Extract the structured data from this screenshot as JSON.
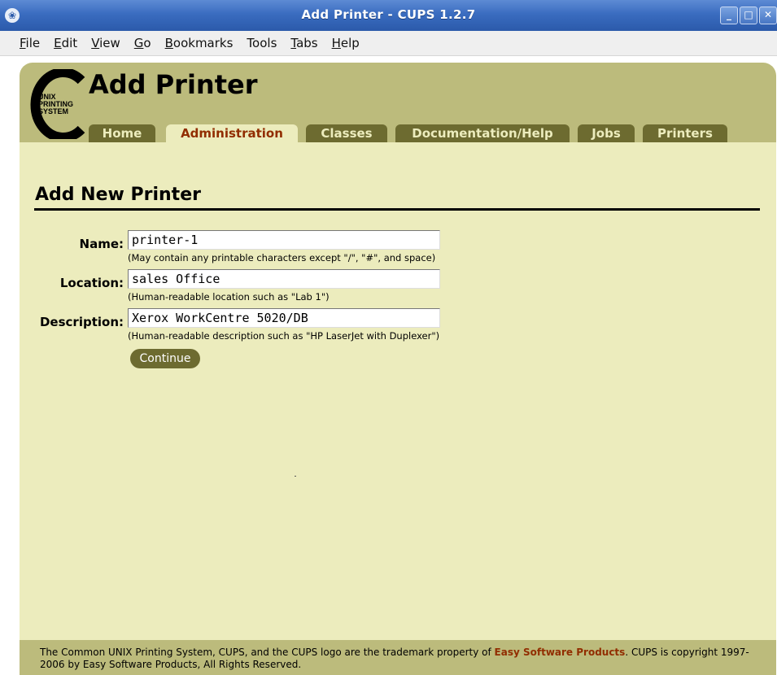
{
  "window": {
    "title": "Add Printer - CUPS 1.2.7",
    "icon": "firefox-icon",
    "controls": [
      "minimize-icon",
      "maximize-icon",
      "close-icon"
    ]
  },
  "menubar": {
    "items": [
      {
        "first": "F",
        "rest": "ile"
      },
      {
        "first": "E",
        "rest": "dit"
      },
      {
        "first": "V",
        "rest": "iew"
      },
      {
        "first": "G",
        "rest": "o"
      },
      {
        "first": "B",
        "rest": "ookmarks"
      },
      {
        "first": "T",
        "rest": "ools"
      },
      {
        "first": "T",
        "rest": "abs"
      },
      {
        "first": "H",
        "rest": "elp"
      }
    ]
  },
  "header": {
    "logo_text": [
      "UNIX",
      "PRINTING",
      "SYSTEM"
    ],
    "page_title": "Add Printer"
  },
  "tabs": [
    {
      "label": "Home",
      "active": false
    },
    {
      "label": "Administration",
      "active": true
    },
    {
      "label": "Classes",
      "active": false
    },
    {
      "label": "Documentation/Help",
      "active": false
    },
    {
      "label": "Jobs",
      "active": false
    },
    {
      "label": "Printers",
      "active": false
    }
  ],
  "main": {
    "section_title": "Add New Printer",
    "fields": [
      {
        "label": "Name:",
        "value": "printer-1",
        "hint": "(May contain any printable characters except \"/\", \"#\", and space)"
      },
      {
        "label": "Location:",
        "value": "sales Office",
        "hint": "(Human-readable location such as \"Lab 1\")"
      },
      {
        "label": "Description:",
        "value": "Xerox WorkCentre 5020/DB",
        "hint": "(Human-readable description such as \"HP LaserJet with Duplexer\")"
      }
    ],
    "continue_label": "Continue"
  },
  "footer": {
    "text_before": "The Common UNIX Printing System, CUPS, and the CUPS logo are the trademark property of ",
    "company": "Easy Software Products",
    "text_after": ". CUPS is copyright 1997-2006 by Easy Software Products, All Rights Reserved."
  },
  "colors": {
    "page_bg": "#ececbd",
    "header_band": "#bcbb7c",
    "tab_bg": "#6d6b30",
    "tab_text": "#ececbd",
    "active_tab_text": "#912d00",
    "link": "#912d00",
    "titlebar": "#3a6cc0"
  }
}
